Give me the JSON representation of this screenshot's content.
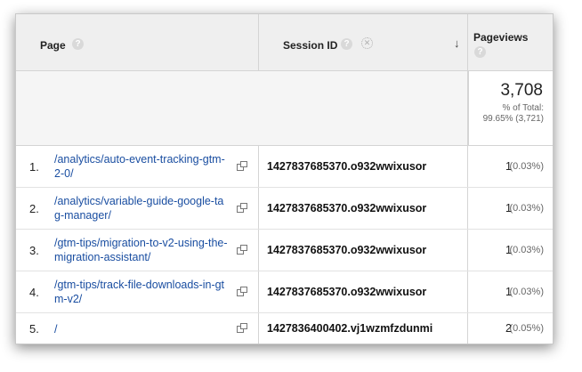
{
  "header": {
    "page_label": "Page",
    "session_label": "Session ID",
    "pageviews_label": "Pageviews",
    "help_glyph": "?"
  },
  "total": {
    "value": "3,708",
    "pct_label": "% of Total:",
    "pct_value": "99.65% (3,721)"
  },
  "rows": [
    {
      "num": "1.",
      "page": "/analytics/auto-event-tracking-gtm-2-0/",
      "session": "1427837685370.o932wwixusor",
      "pageviews": "1",
      "pct": "(0.03%)"
    },
    {
      "num": "2.",
      "page": "/analytics/variable-guide-google-tag-manager/",
      "session": "1427837685370.o932wwixusor",
      "pageviews": "1",
      "pct": "(0.03%)"
    },
    {
      "num": "3.",
      "page": "/gtm-tips/migration-to-v2-using-the-migration-assistant/",
      "session": "1427837685370.o932wwixusor",
      "pageviews": "1",
      "pct": "(0.03%)"
    },
    {
      "num": "4.",
      "page": "/gtm-tips/track-file-downloads-in-gtm-v2/",
      "session": "1427837685370.o932wwixusor",
      "pageviews": "1",
      "pct": "(0.03%)"
    },
    {
      "num": "5.",
      "page": "/",
      "session": "1427836400402.vj1wzmfzdunmi",
      "pageviews": "2",
      "pct": "(0.05%)"
    }
  ],
  "icons": {
    "help": "question-mark-circle",
    "remove": "remove-dimension-circle",
    "sort": "down-arrow",
    "popout": "open-in-new-window"
  },
  "colors": {
    "link": "#1a4ea1",
    "header_bg": "#efefef"
  }
}
